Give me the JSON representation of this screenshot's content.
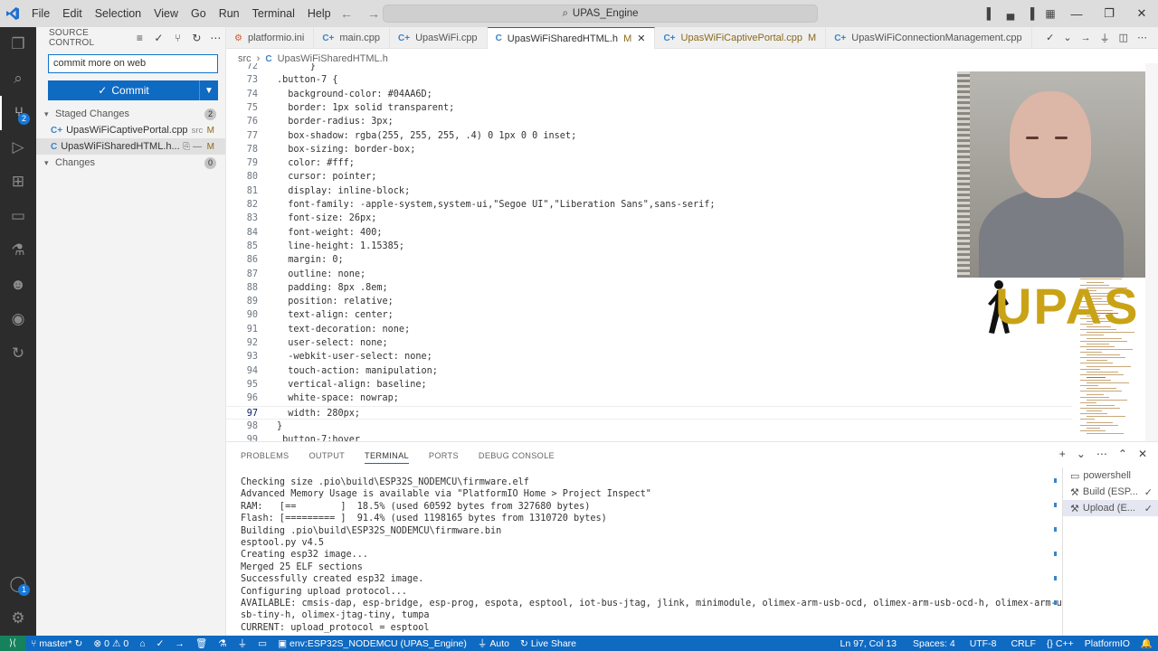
{
  "titlebar": {
    "menu": [
      "File",
      "Edit",
      "Selection",
      "View",
      "Go",
      "Run",
      "Terminal",
      "Help"
    ],
    "search_text": "UPAS_Engine"
  },
  "sidebar": {
    "title": "SOURCE CONTROL",
    "commit_message": "commit more on web",
    "commit_label": "Commit",
    "staged": {
      "label": "Staged Changes",
      "count": "2",
      "files": [
        {
          "name": "UpasWiFiCaptivePortal.cpp",
          "path": "src",
          "status": "M"
        },
        {
          "name": "UpasWiFiSharedHTML.h...",
          "path": "",
          "status": "M"
        }
      ]
    },
    "changes": {
      "label": "Changes",
      "count": "0"
    },
    "scm_badge": "2",
    "account_badge": "1"
  },
  "tabs": [
    {
      "label": "platformio.ini",
      "icon": "gear-icon",
      "mod": ""
    },
    {
      "label": "main.cpp",
      "icon": "cpp-icon",
      "mod": ""
    },
    {
      "label": "UpasWiFi.cpp",
      "icon": "cpp-icon",
      "mod": ""
    },
    {
      "label": "UpasWiFiSharedHTML.h",
      "icon": "c-icon",
      "mod": "M"
    },
    {
      "label": "UpasWiFiCaptivePortal.cpp",
      "icon": "cpp-icon",
      "mod": "M"
    },
    {
      "label": "UpasWiFiConnectionManagement.cpp",
      "icon": "cpp-icon",
      "mod": ""
    }
  ],
  "breadcrumb": {
    "folder": "src",
    "file": "UpasWiFiSharedHTML.h"
  },
  "editor": {
    "lines": [
      {
        "n": "72",
        "t": "      }"
      },
      {
        "n": "73",
        "t": ".button-7 {"
      },
      {
        "n": "74",
        "t": "  background-color: #04AA6D;"
      },
      {
        "n": "75",
        "t": "  border: 1px solid transparent;"
      },
      {
        "n": "76",
        "t": "  border-radius: 3px;"
      },
      {
        "n": "77",
        "t": "  box-shadow: rgba(255, 255, 255, .4) 0 1px 0 0 inset;"
      },
      {
        "n": "78",
        "t": "  box-sizing: border-box;"
      },
      {
        "n": "79",
        "t": "  color: #fff;"
      },
      {
        "n": "80",
        "t": "  cursor: pointer;"
      },
      {
        "n": "81",
        "t": "  display: inline-block;"
      },
      {
        "n": "82",
        "t": "  font-family: -apple-system,system-ui,\"Segoe UI\",\"Liberation Sans\",sans-serif;"
      },
      {
        "n": "83",
        "t": "  font-size: 26px;"
      },
      {
        "n": "84",
        "t": "  font-weight: 400;"
      },
      {
        "n": "85",
        "t": "  line-height: 1.15385;"
      },
      {
        "n": "86",
        "t": "  margin: 0;"
      },
      {
        "n": "87",
        "t": "  outline: none;"
      },
      {
        "n": "88",
        "t": "  padding: 8px .8em;"
      },
      {
        "n": "89",
        "t": "  position: relative;"
      },
      {
        "n": "90",
        "t": "  text-align: center;"
      },
      {
        "n": "91",
        "t": "  text-decoration: none;"
      },
      {
        "n": "92",
        "t": "  user-select: none;"
      },
      {
        "n": "93",
        "t": "  -webkit-user-select: none;"
      },
      {
        "n": "94",
        "t": "  touch-action: manipulation;"
      },
      {
        "n": "95",
        "t": "  vertical-align: baseline;"
      },
      {
        "n": "96",
        "t": "  white-space: nowrap;"
      },
      {
        "n": "97",
        "t": "  width: 280px;"
      },
      {
        "n": "98",
        "t": "}"
      },
      {
        "n": "99",
        "t": " button-7:hover"
      }
    ],
    "current_line": "97"
  },
  "overlay": {
    "logo_text": "UPAS"
  },
  "panel": {
    "tabs": [
      "PROBLEMS",
      "OUTPUT",
      "TERMINAL",
      "PORTS",
      "DEBUG CONSOLE"
    ],
    "active_tab": "TERMINAL",
    "terminal_lines": [
      "Checking size .pio\\build\\ESP32S_NODEMCU\\firmware.elf",
      "Advanced Memory Usage is available via \"PlatformIO Home > Project Inspect\"",
      "RAM:   [==        ]  18.5% (used 60592 bytes from 327680 bytes)",
      "Flash: [========= ]  91.4% (used 1198165 bytes from 1310720 bytes)",
      "Building .pio\\build\\ESP32S_NODEMCU\\firmware.bin",
      "esptool.py v4.5",
      "Creating esp32 image...",
      "Merged 25 ELF sections",
      "Successfully created esp32 image.",
      "Configuring upload protocol...",
      "AVAILABLE: cmsis-dap, esp-bridge, esp-prog, espota, esptool, iot-bus-jtag, jlink, minimodule, olimex-arm-usb-ocd, olimex-arm-usb-ocd-h, olimex-arm-u",
      "sb-tiny-h, olimex-jtag-tiny, tumpa",
      "CURRENT: upload_protocol = esptool"
    ],
    "terminals": [
      {
        "label": "powershell",
        "check": ""
      },
      {
        "label": "Build (ESP...",
        "check": "✓"
      },
      {
        "label": "Upload (E...",
        "check": "✓"
      }
    ]
  },
  "statusbar": {
    "branch": "master*",
    "problems": "0",
    "warnings": "0",
    "env": "env:ESP32S_NODEMCU (UPAS_Engine)",
    "auto": "Auto",
    "live_share": "Live Share",
    "position": "Ln 97, Col 13",
    "spaces": "Spaces: 4",
    "encoding": "UTF-8",
    "eol": "CRLF",
    "language": "C++",
    "platform": "PlatformIO"
  }
}
